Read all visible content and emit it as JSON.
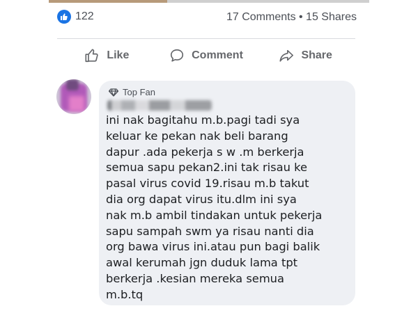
{
  "post": {
    "reaction_count": "122",
    "comments_shares": "17 Comments • 15 Shares"
  },
  "actions": {
    "like": "Like",
    "comment": "Comment",
    "share": "Share"
  },
  "comment": {
    "badge": "Top Fan",
    "author_name_obscured": "Ai...",
    "text_lines": [
      "ini nak bagitahu m.b.pagi tadi sya",
      "keluar ke pekan nak beli barang",
      "dapur .ada pekerja s w .m berkerja",
      "semua sapu pekan2.ini tak risau ke",
      "pasal virus covid 19.risau m.b takut",
      "dia org dapat virus itu.dlm ini sya",
      "nak m.b ambil tindakan untuk pekerja",
      "sapu sampah swm ya risau nanti dia",
      "org bawa virus ini.atau pun bagi balik",
      "awal kerumah jgn duduk lama tpt",
      "berkerja .kesian mereka semua",
      "m.b.tq"
    ]
  },
  "colors": {
    "like_blue": "#1b74e4",
    "muted_text": "#65676b",
    "bubble_bg": "#eef0f4"
  }
}
